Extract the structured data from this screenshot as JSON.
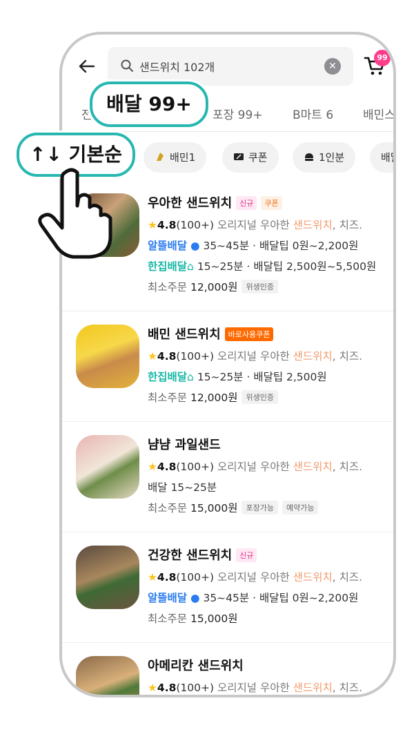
{
  "search": {
    "query": "샌드위치 102개",
    "clear_icon": "clear-icon",
    "back_icon": "arrow-left-icon"
  },
  "cart": {
    "badge": "99",
    "icon": "cart-icon"
  },
  "tabs": [
    {
      "label": "전"
    },
    {
      "label": "포장 99+"
    },
    {
      "label": "B마트 6"
    },
    {
      "label": "배민스"
    }
  ],
  "callouts": {
    "delivery": "배달 99+",
    "sort": "↑↓ 기본순"
  },
  "chips": [
    {
      "label": "배민1",
      "icon": "baemin1-icon"
    },
    {
      "label": "쿠폰",
      "icon": "coupon-icon"
    },
    {
      "label": "1인분",
      "icon": "single-portion-icon"
    },
    {
      "label": "배달"
    }
  ],
  "stores": [
    {
      "name": "우아한 샌드위치",
      "tags": [
        "신규",
        "쿠폰"
      ],
      "rating": "4.8",
      "reviews": "(100+)",
      "desc_pre": "오리지널 우아한 ",
      "desc_hl": "샌드위치",
      "desc_post": ", 치즈.",
      "delivery_lines": [
        {
          "type": "알뜰배달",
          "time": "35~45분",
          "tip": "배달팁 0원~2,200원"
        },
        {
          "type": "한집배달",
          "time": "15~25분",
          "tip": "배달팁 2,500원~5,500원"
        }
      ],
      "min_order_label": "최소주문",
      "min_order": "12,000원",
      "badges": [
        "위생인증"
      ]
    },
    {
      "name": "배민 샌드위치",
      "tags": [
        "바로사용쿠폰"
      ],
      "rating": "4.8",
      "reviews": "(100+)",
      "desc_pre": "오리지널 우아한 ",
      "desc_hl": "샌드위치",
      "desc_post": ", 치즈.",
      "delivery_lines": [
        {
          "type": "한집배달",
          "time": "15~25분",
          "tip": "배달팁 2,500원"
        }
      ],
      "min_order_label": "최소주문",
      "min_order": "12,000원",
      "badges": [
        "위생인증"
      ]
    },
    {
      "name": "냠냠 과일샌드",
      "tags": [],
      "rating": "4.8",
      "reviews": "(100+)",
      "desc_pre": "오리지널 우아한 ",
      "desc_hl": "샌드위치",
      "desc_post": ", 치즈.",
      "plain_delivery": "배달 15~25분",
      "min_order_label": "최소주문",
      "min_order": "15,000원",
      "badges": [
        "포장가능",
        "예약가능"
      ]
    },
    {
      "name": "건강한 샌드위치",
      "tags": [
        "신규"
      ],
      "rating": "4.8",
      "reviews": "(100+)",
      "desc_pre": "오리지널 우아한 ",
      "desc_hl": "샌드위치",
      "desc_post": ", 치즈.",
      "delivery_lines": [
        {
          "type": "알뜰배달",
          "time": "35~45분",
          "tip": "배달팁 0원~2,200원"
        }
      ],
      "min_order_label": "최소주문",
      "min_order": "15,000원",
      "badges": []
    },
    {
      "name": "아메리칸 샌드위치",
      "tags": [],
      "rating": "4.8",
      "reviews": "(100+)",
      "desc_pre": "오리지널 우아한 ",
      "desc_hl": "샌드위치",
      "desc_post": ", 치즈."
    }
  ],
  "colors": {
    "accent_teal": "#27b7b0",
    "badge_pink": "#ff3d8b",
    "alttl_blue": "#2b7cf0",
    "hanjib_teal": "#17b8a6"
  }
}
